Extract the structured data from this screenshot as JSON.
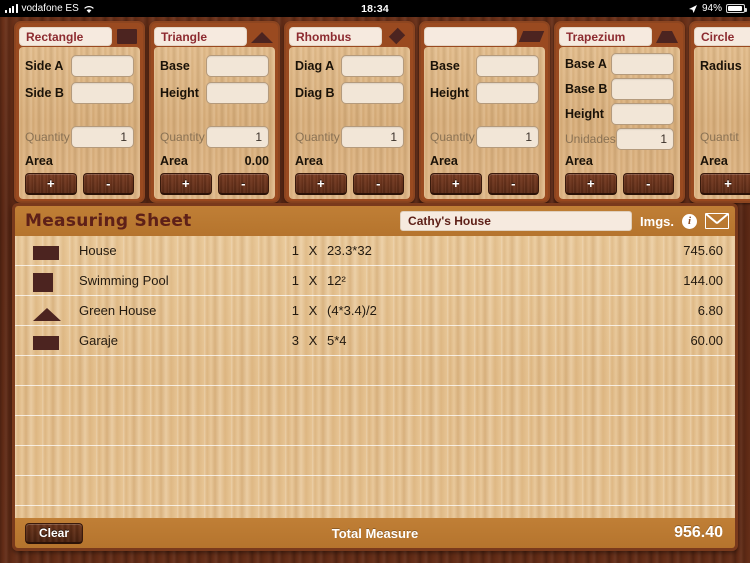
{
  "status_bar": {
    "carrier": "vodafone ES",
    "signal_icon": "signal-bars-icon",
    "wifi_icon": "wifi-icon",
    "time": "18:34",
    "location_icon": "location-arrow-icon",
    "battery_percent": "94%",
    "battery_icon": "battery-charging-icon"
  },
  "panels": [
    {
      "title": "Rectangle",
      "icon": "square",
      "fields": [
        {
          "label": "Side A",
          "value": ""
        },
        {
          "label": "Side B",
          "value": ""
        }
      ],
      "quantity_label": "Quantity",
      "quantity_value": "1",
      "area_label": "Area",
      "area_value": "",
      "add_label": "+",
      "sub_label": "-"
    },
    {
      "title": "Triangle",
      "icon": "triangle",
      "fields": [
        {
          "label": "Base",
          "value": ""
        },
        {
          "label": "Height",
          "value": ""
        }
      ],
      "quantity_label": "Quantity",
      "quantity_value": "1",
      "area_label": "Area",
      "area_value": "0.00",
      "add_label": "+",
      "sub_label": "-"
    },
    {
      "title": "Rhombus",
      "icon": "rhombus",
      "fields": [
        {
          "label": "Diag A",
          "value": ""
        },
        {
          "label": "Diag B",
          "value": ""
        }
      ],
      "quantity_label": "Quantity",
      "quantity_value": "1",
      "area_label": "Area",
      "area_value": "",
      "add_label": "+",
      "sub_label": "-"
    },
    {
      "title": "",
      "icon": "parallelogram",
      "fields": [
        {
          "label": "Base",
          "value": ""
        },
        {
          "label": "Height",
          "value": ""
        }
      ],
      "quantity_label": "Quantity",
      "quantity_value": "1",
      "area_label": "Area",
      "area_value": "",
      "add_label": "+",
      "sub_label": "-"
    },
    {
      "title": "Trapezium",
      "icon": "trapezium",
      "fields": [
        {
          "label": "Base A",
          "value": ""
        },
        {
          "label": "Base B",
          "value": ""
        },
        {
          "label": "Height",
          "value": ""
        }
      ],
      "quantity_label": "Unidades",
      "quantity_value": "1",
      "area_label": "Area",
      "area_value": "",
      "add_label": "+",
      "sub_label": "-"
    },
    {
      "title": "Circle",
      "icon": "circle",
      "fields": [
        {
          "label": "Radius",
          "value": ""
        }
      ],
      "quantity_label": "Quantit",
      "quantity_value": "",
      "area_label": "Area",
      "area_value": "",
      "add_label": "+",
      "sub_label": "-"
    }
  ],
  "sheet": {
    "title": "Measuring Sheet",
    "project_name": "Cathy's House",
    "project_name_placeholder": "Cathy's House",
    "images_label": "Imgs.",
    "info_icon": "info-icon",
    "mail_icon": "mail-icon",
    "rows": [
      {
        "icon": "rect",
        "name": "House",
        "qty": "1",
        "x": "X",
        "formula": "23.3*32",
        "value": "745.60"
      },
      {
        "icon": "square",
        "name": "Swimming Pool",
        "qty": "1",
        "x": "X",
        "formula": "12²",
        "value": "144.00"
      },
      {
        "icon": "triangle",
        "name": "Green House",
        "qty": "1",
        "x": "X",
        "formula": "(4*3.4)/2",
        "value": "6.80"
      },
      {
        "icon": "rect",
        "name": "Garaje",
        "qty": "3",
        "x": "X",
        "formula": "5*4",
        "value": "60.00"
      }
    ],
    "empty_row_count": 6,
    "footer": {
      "clear_label": "Clear",
      "total_label": "Total Measure",
      "total_value": "956.40"
    }
  },
  "colors": {
    "frame_brown": "#5c2a18",
    "panel_orange": "#9a4a20",
    "header_orange": "#b5742d",
    "wood_light": "#e3bd88",
    "shape_dark": "#4c2420",
    "title_red": "#8d2b30"
  }
}
